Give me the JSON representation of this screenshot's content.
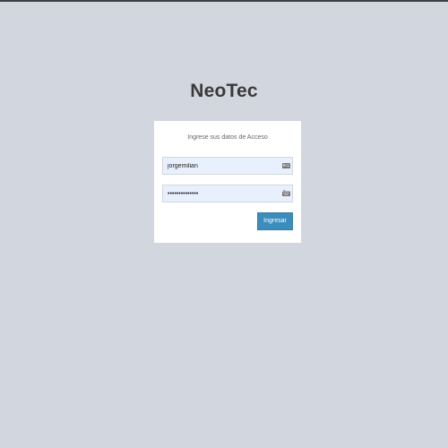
{
  "app": {
    "title": "NeoTec"
  },
  "login": {
    "message": "Ingrese sus datos de Acceso",
    "username": {
      "value": "jorgemilian",
      "icon": "id-card-icon"
    },
    "password": {
      "value": "••••••••••••••",
      "icon": "keyboard-icon"
    },
    "submit_label": "Ingresar"
  },
  "colors": {
    "background": "#d2d6de",
    "box": "#ffffff",
    "input_fill": "#e8f0fe",
    "button": "#3c8dbc",
    "button_text": "#ffffff"
  }
}
